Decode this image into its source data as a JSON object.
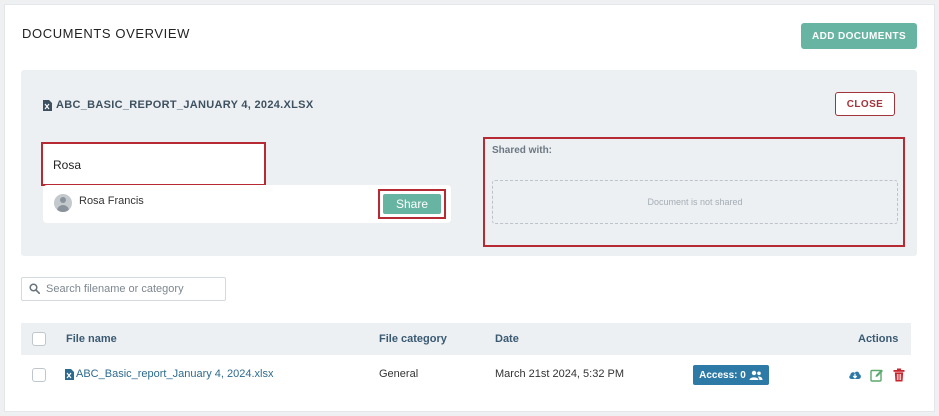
{
  "header": {
    "title": "DOCUMENTS OVERVIEW",
    "add_button": "ADD DOCUMENTS"
  },
  "panel": {
    "file_title": "ABC_BASIC_REPORT_JANUARY 4, 2024.XLSX",
    "close_button": "CLOSE",
    "user_search_value": "Rosa",
    "user_result": "Rosa Francis",
    "share_button": "Share",
    "shared_with_label": "Shared with:",
    "not_shared_text": "Document is not shared"
  },
  "filter": {
    "placeholder": "Search filename or category"
  },
  "table": {
    "columns": [
      "File name",
      "File category",
      "Date",
      "Actions"
    ],
    "rows": [
      {
        "file_name": "ABC_Basic_report_January 4, 2024.xlsx",
        "category": "General",
        "date": "March 21st 2024, 5:32 PM",
        "access": "Access: 0"
      }
    ]
  },
  "colors": {
    "accent": "#68b4a2",
    "danger": "#a0343a",
    "highlight": "#b62a33",
    "access": "#2d7aa6"
  },
  "icons": {
    "file": "excel-file-icon",
    "user": "avatar-icon",
    "search": "search-icon",
    "access": "users-icon",
    "download": "cloud-download-icon",
    "edit": "edit-icon",
    "delete": "trash-icon"
  }
}
